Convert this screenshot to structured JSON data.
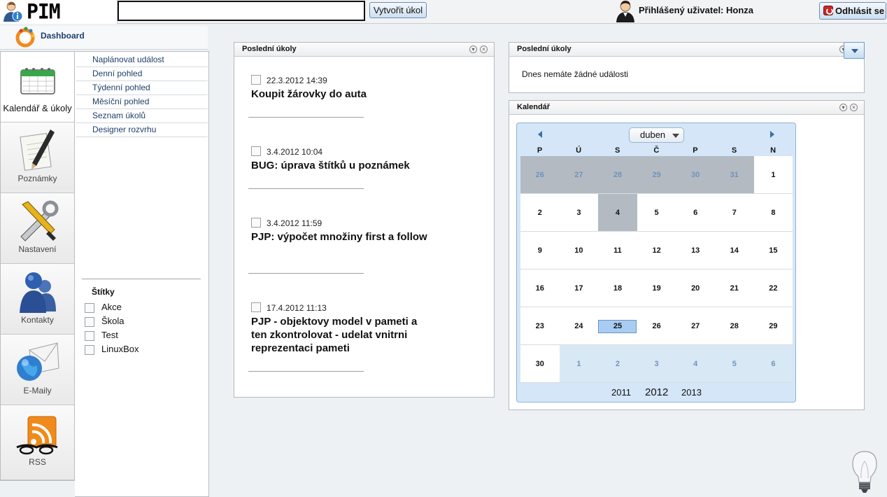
{
  "app": {
    "logo_text": "PIM"
  },
  "topbar": {
    "quick_task_value": "",
    "create_task_label": "Vytvořit úkol",
    "user_label": "Přihlášený uživatel: Honza",
    "logout_label": "Odhlásit se"
  },
  "dashboard": {
    "label": "Dashboard"
  },
  "leftnav": {
    "items": [
      {
        "label": "Kalendář & úkoly",
        "icon": "calendar-icon",
        "active": true
      },
      {
        "label": "Poznámky",
        "icon": "notepad-pencil-icon"
      },
      {
        "label": "Nastavení",
        "icon": "tools-icon"
      },
      {
        "label": "Kontakty",
        "icon": "contacts-icon"
      },
      {
        "label": "E-Maily",
        "icon": "email-globe-icon"
      },
      {
        "label": "RSS",
        "icon": "rss-icon"
      }
    ]
  },
  "subnav": {
    "links": [
      "Naplánovat událost",
      "Denní pohled",
      "Týdenní pohled",
      "Měsíční pohled",
      "Seznam úkolů",
      "Designer rozvrhu"
    ],
    "tags_title": "Štítky",
    "tags": [
      "Akce",
      "Škola",
      "Test",
      "LinuxBox"
    ]
  },
  "tasks_panel": {
    "title": "Poslední úkoly",
    "tasks": [
      {
        "when": "22.3.2012 14:39",
        "title": "Koupit žárovky do auta"
      },
      {
        "when": "3.4.2012 10:04",
        "title": "BUG: úprava štítků u poznámek"
      },
      {
        "when": "3.4.2012 11:59",
        "title": "PJP: výpočet množiny first a follow"
      },
      {
        "when": "17.4.2012 11:13",
        "title": "PJP - objektovy model v pameti a ten zkontrolovat - udelat vnitrni reprezentaci pameti"
      }
    ]
  },
  "events_panel": {
    "title": "Poslední úkoly",
    "empty_text": "Dnes nemáte žádné události"
  },
  "calendar_panel": {
    "title": "Kalendář",
    "month": "duben",
    "weekdays": [
      "P",
      "Ú",
      "S",
      "Č",
      "P",
      "S",
      "N"
    ],
    "weeks": [
      [
        "26",
        "27",
        "28",
        "29",
        "30",
        "31",
        "1"
      ],
      [
        "2",
        "3",
        "4",
        "5",
        "6",
        "7",
        "8"
      ],
      [
        "9",
        "10",
        "11",
        "12",
        "13",
        "14",
        "15"
      ],
      [
        "16",
        "17",
        "18",
        "19",
        "20",
        "21",
        "22"
      ],
      [
        "23",
        "24",
        "25",
        "26",
        "27",
        "28",
        "29"
      ],
      [
        "30",
        "1",
        "2",
        "3",
        "4",
        "5",
        "6"
      ]
    ],
    "today": "25",
    "years": [
      "2011",
      "2012",
      "2013"
    ]
  }
}
